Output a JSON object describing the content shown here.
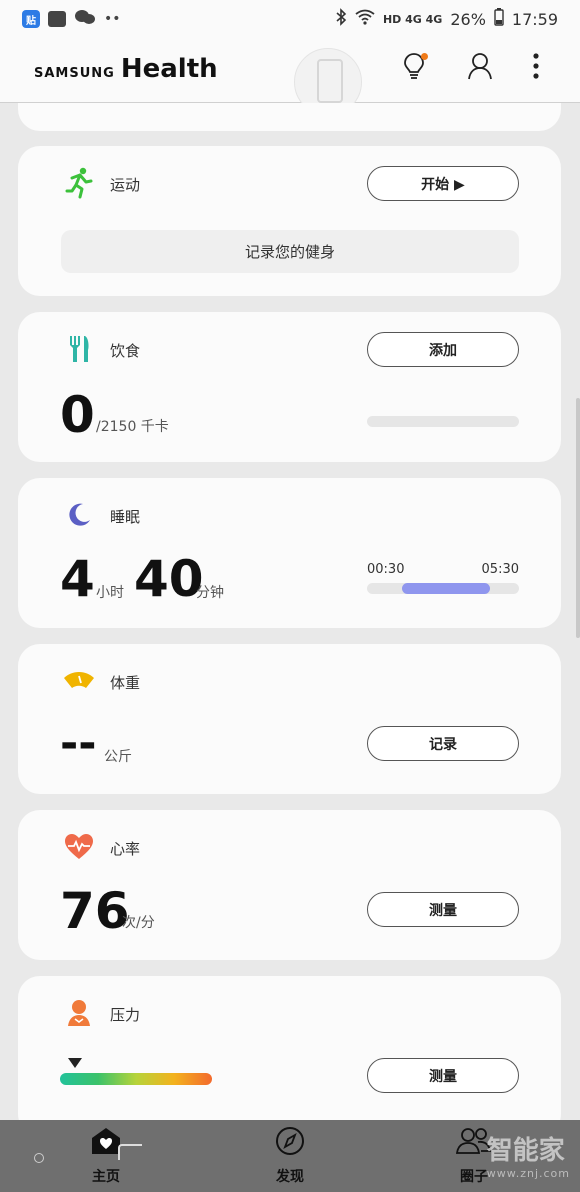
{
  "status_bar": {
    "app_badge": "贴",
    "network": "HD 4G 4G",
    "battery": "26%",
    "time": "17:59"
  },
  "app_bar": {
    "brand_small": "SAMSUNG",
    "brand_large": "Health"
  },
  "cards": {
    "exercise": {
      "title": "运动",
      "start_label": "开始 ▶",
      "record_label": "记录您的健身"
    },
    "food": {
      "title": "饮食",
      "add_label": "添加",
      "value": "0",
      "goal": "/2150 千卡",
      "progress": 0
    },
    "sleep": {
      "title": "睡眠",
      "hours": "4",
      "hours_unit": "小时",
      "minutes": "40",
      "minutes_unit": "分钟",
      "start_time": "00:30",
      "end_time": "05:30"
    },
    "weight": {
      "title": "体重",
      "value": "--",
      "unit": "公斤",
      "record_label": "记录"
    },
    "heart_rate": {
      "title": "心率",
      "value": "76",
      "unit": "次/分",
      "measure_label": "测量"
    },
    "stress": {
      "title": "压力",
      "measure_label": "测量",
      "level": 0.1
    }
  },
  "bottom_nav": {
    "home": "主页",
    "discover": "发现",
    "together": "圈子"
  },
  "watermark": {
    "text": "智能家",
    "url": "www.znj.com"
  },
  "colors": {
    "exercise_icon": "#3cc13b",
    "food_icon": "#2fb5a6",
    "sleep_icon": "#5b5fc4",
    "weight_icon": "#f0b400",
    "heart_icon": "#ef6a4a",
    "stress_icon": "#f07a3a",
    "sleep_bar": "#8f96ee"
  }
}
